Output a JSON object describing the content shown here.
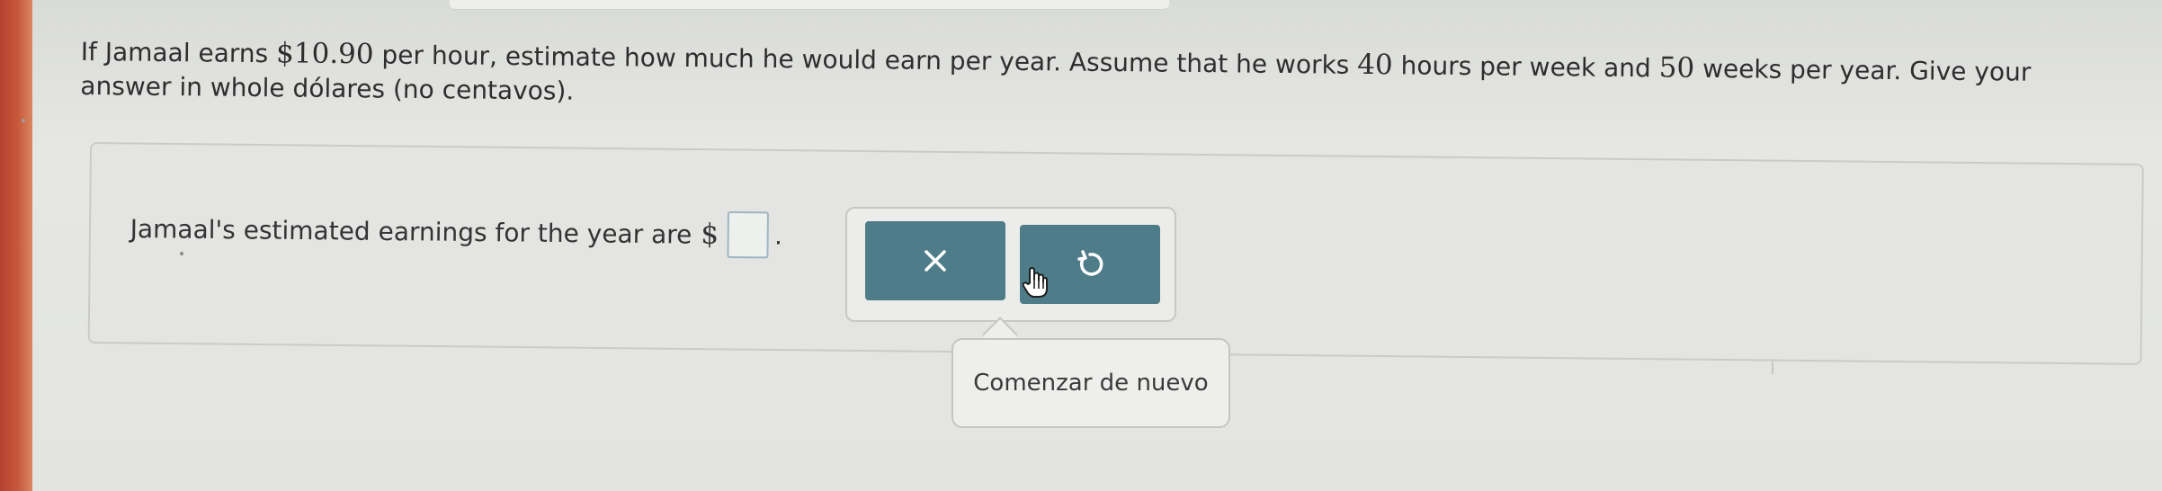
{
  "question": {
    "part1": "If Jamaal earns ",
    "wage": "$10.90",
    "part2": " per hour, estimate how much he would earn per year. Assume that he works ",
    "hours": "40",
    "part3": " hours per week and ",
    "weeks": "50",
    "part4": " weeks per year. Give your answer in whole dólares (no centavos)."
  },
  "answer": {
    "prompt": "Jamaal's estimated earnings for the year are",
    "currency": "$",
    "value": "",
    "end": "."
  },
  "tools": {
    "clear_symbol": "✕",
    "reset_symbol": "↻",
    "button_color": "#4e7c88"
  },
  "tooltip": {
    "text": "Comenzar de nuevo"
  }
}
